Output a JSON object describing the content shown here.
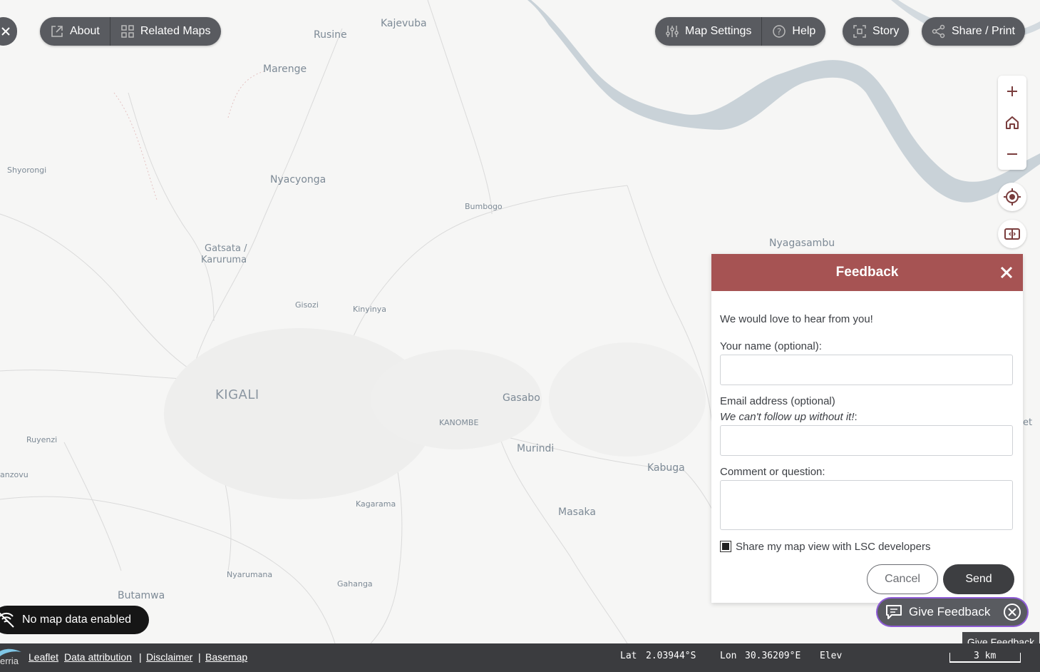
{
  "nav": {
    "about_label": "About",
    "related_maps_label": "Related Maps",
    "map_settings_label": "Map Settings",
    "help_label": "Help",
    "story_label": "Story",
    "share_label": "Share / Print"
  },
  "map": {
    "places": {
      "rusine": "Rusine",
      "kajevuba": "Kajevuba",
      "marenge": "Marenge",
      "shyorongi": "Shyorongi",
      "nyacyonga": "Nyacyonga",
      "bumbogo": "Bumbogo",
      "gatsata_1": "Gatsata /",
      "gatsata_2": "Karuruma",
      "gisozi": "Gisozi",
      "kinyinya": "Kinyinya",
      "nyagasambu": "Nyagasambu",
      "kigali": "KIGALI",
      "gasabo": "Gasabo",
      "kanombe": "KANOMBE",
      "murindi": "Murindi",
      "ruyenzi": "Ruyenzi",
      "anzovu": "anzovu",
      "kabuga": "Kabuga",
      "kagarama": "Kagarama",
      "masaka": "Masaka",
      "nyarumana": "Nyarumana",
      "gahanga": "Gahanga",
      "butamwa": "Butamwa",
      "et": "et"
    },
    "water_color": "#c9d2d8"
  },
  "feedback": {
    "title": "Feedback",
    "intro": "We would love to hear from you!",
    "name_label": "Your name (optional):",
    "name_value": "",
    "email_label": "Email address (optional)",
    "email_note": "We can't follow up without it!",
    "email_note_suffix": ":",
    "email_value": "",
    "comment_label": "Comment or question:",
    "comment_value": "",
    "share_label": "Share my map view with LSC developers",
    "share_checked": true,
    "cancel_label": "Cancel",
    "send_label": "Send",
    "header_color": "#a65353"
  },
  "give_feedback": {
    "label": "Give Feedback",
    "tooltip": "Give Feedback",
    "outline_color": "#8e5bd6"
  },
  "status": {
    "no_data": "No map data enabled"
  },
  "bottom": {
    "brand": "erria",
    "leaflet": "Leaflet",
    "data_attribution": "Data attribution",
    "sep": "|",
    "disclaimer": "Disclaimer",
    "basemap": "Basemap",
    "lat_label": "Lat",
    "lat_value": "2.03944°S",
    "lon_label": "Lon",
    "lon_value": "30.36209°E",
    "elev_label": "Elev",
    "scale_label": "3 km"
  }
}
